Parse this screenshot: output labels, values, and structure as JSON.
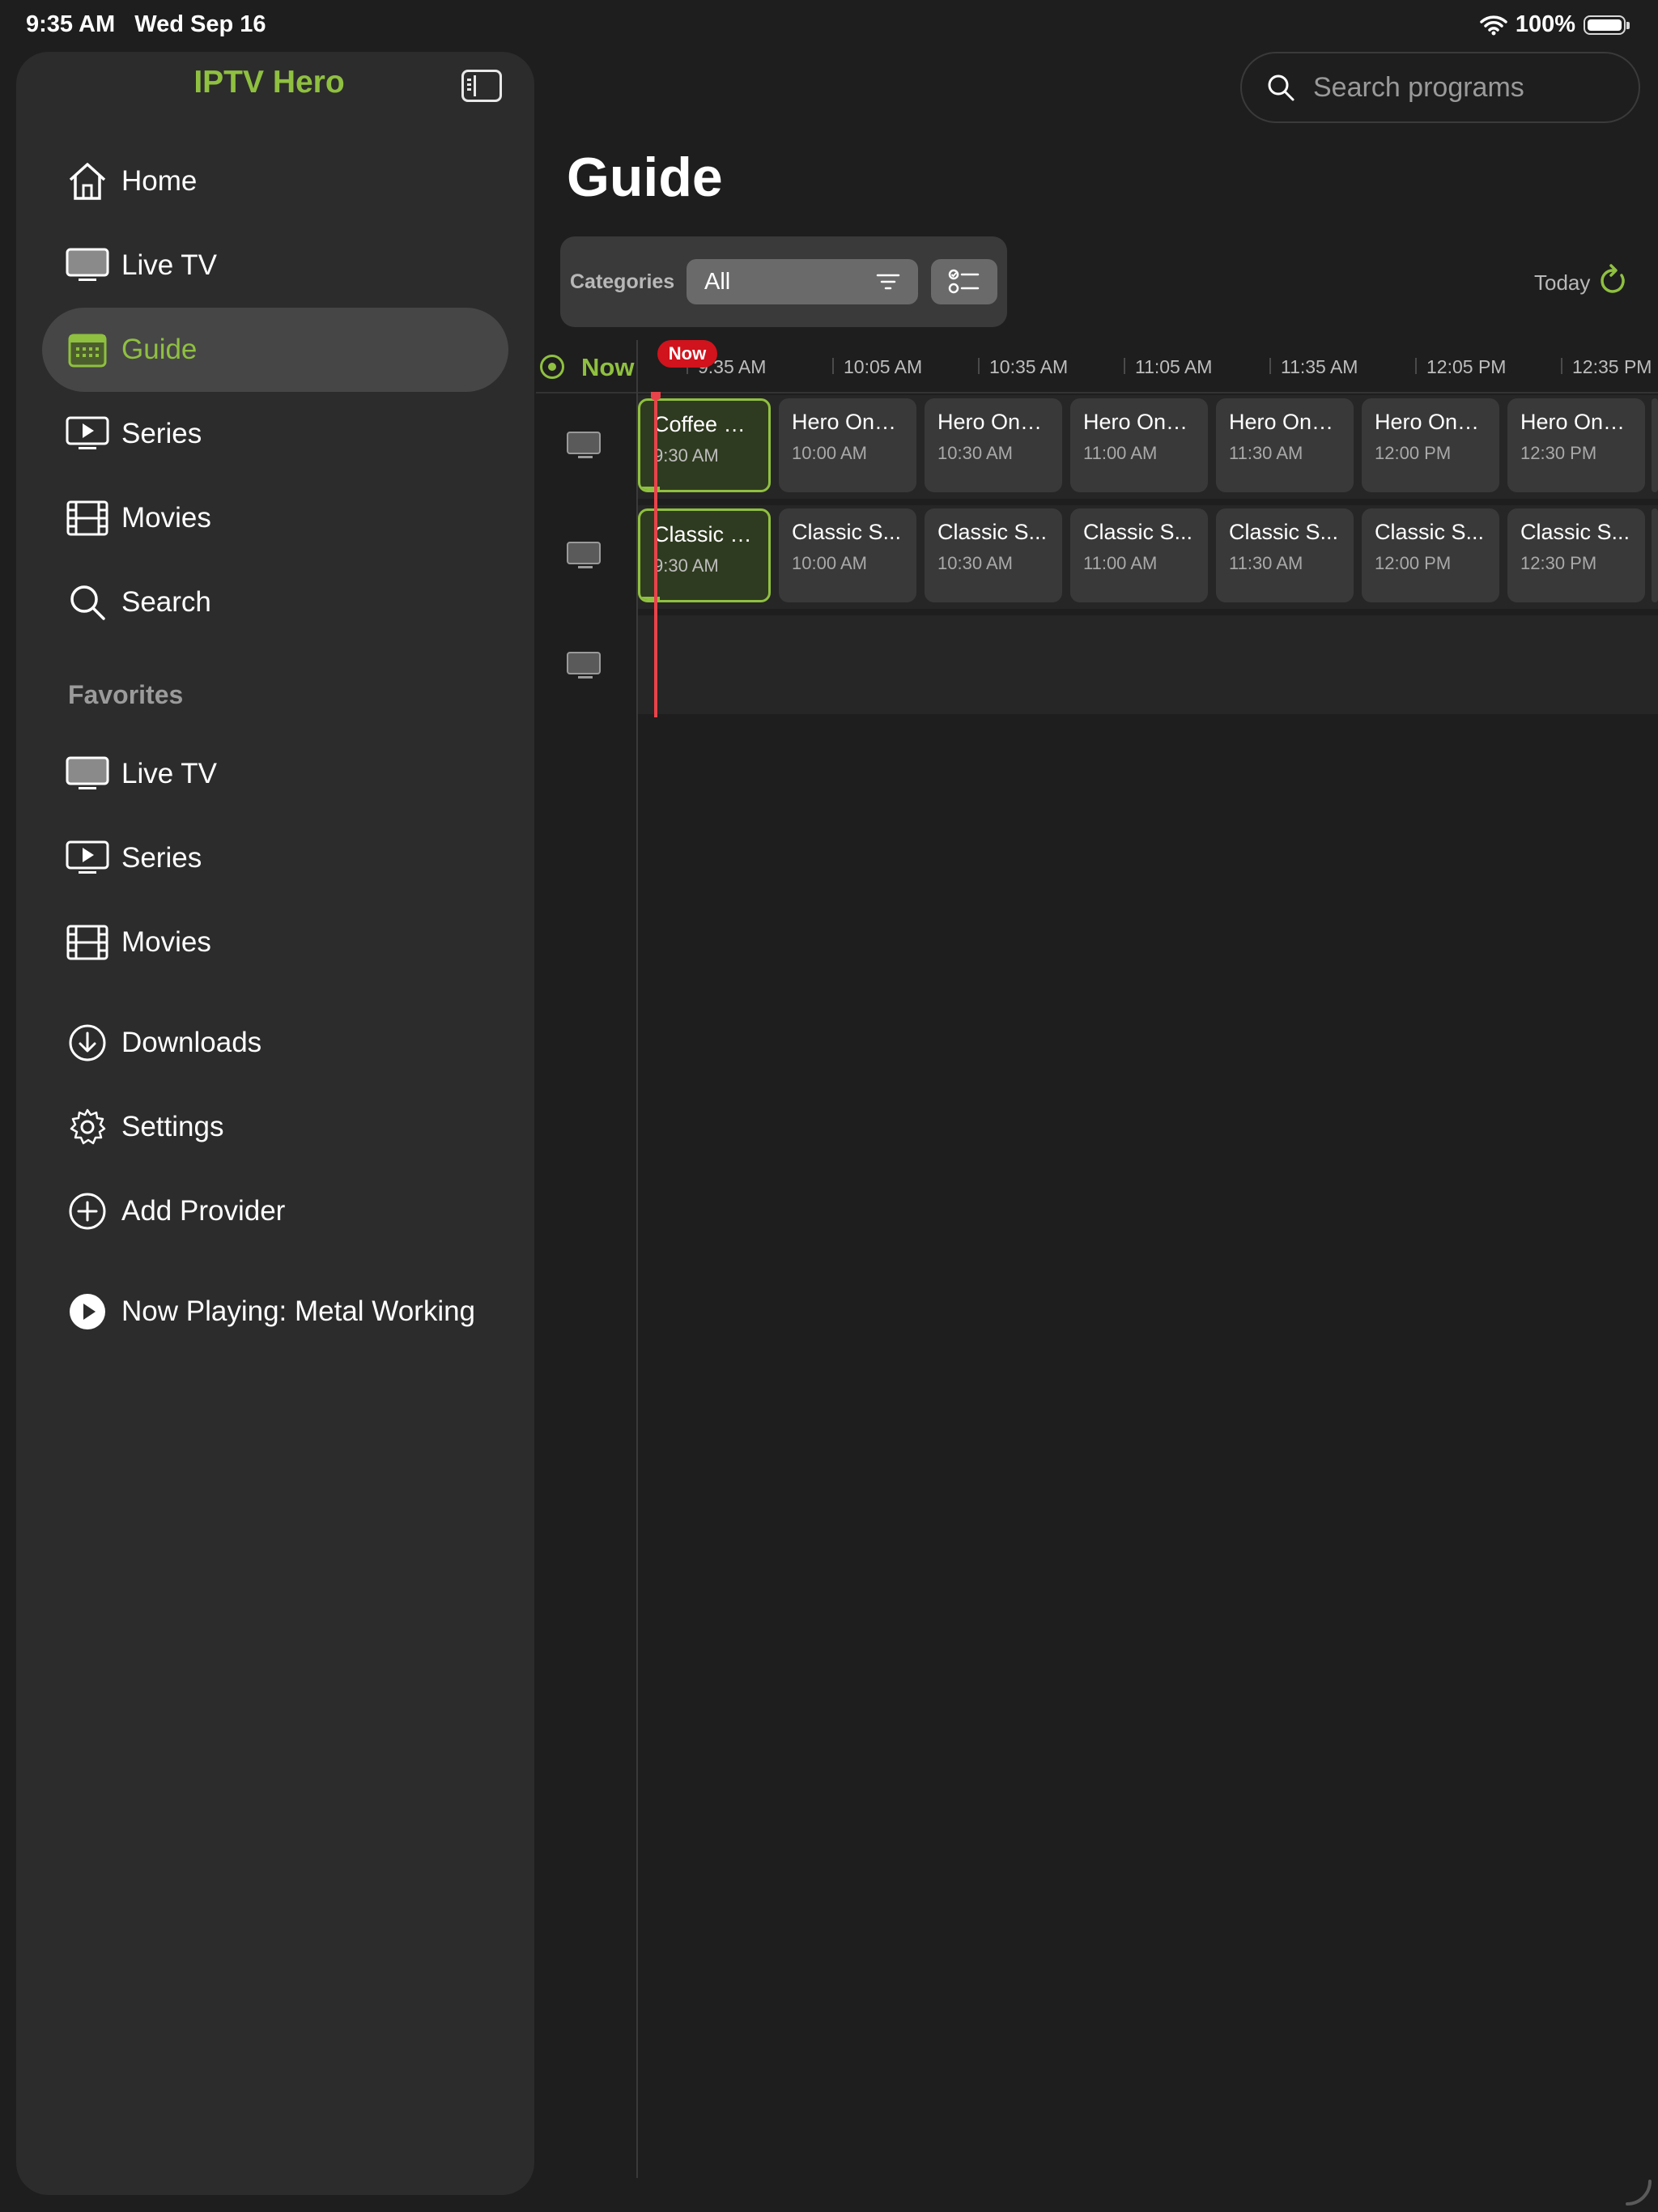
{
  "status_bar": {
    "time": "9:35 AM",
    "date": "Wed Sep 16",
    "battery": "100%"
  },
  "sidebar": {
    "app_title": "IPTV Hero",
    "items": [
      {
        "label": "Home",
        "icon": "house-icon"
      },
      {
        "label": "Live TV",
        "icon": "tv-icon"
      },
      {
        "label": "Guide",
        "icon": "calendar-icon",
        "active": true
      },
      {
        "label": "Series",
        "icon": "play-rectangle-icon"
      },
      {
        "label": "Movies",
        "icon": "film-icon"
      },
      {
        "label": "Search",
        "icon": "search-icon"
      }
    ],
    "favorites_label": "Favorites",
    "favorites": [
      {
        "label": "Live TV",
        "icon": "tv-icon"
      },
      {
        "label": "Series",
        "icon": "play-rectangle-icon"
      },
      {
        "label": "Movies",
        "icon": "film-icon"
      }
    ],
    "extras": [
      {
        "label": "Downloads",
        "icon": "download-circle-icon"
      },
      {
        "label": "Settings",
        "icon": "gear-icon"
      },
      {
        "label": "Add Provider",
        "icon": "plus-circle-icon"
      }
    ],
    "now_playing": "Now Playing: Metal Working"
  },
  "header": {
    "search_placeholder": "Search programs",
    "title": "Guide"
  },
  "filters": {
    "categories_label": "Categories",
    "selected": "All",
    "today_label": "Today"
  },
  "timeline": {
    "now_label": "Now",
    "now_badge": "Now",
    "times": [
      "9:35 AM",
      "10:05 AM",
      "10:35 AM",
      "11:05 AM",
      "11:35 AM",
      "12:05 PM",
      "12:35 PM"
    ]
  },
  "channels": [
    {
      "programs": [
        {
          "title": "Coffee &...",
          "time": "9:30 AM",
          "current": true,
          "progress": 0.15
        },
        {
          "title": "Hero One...",
          "time": "10:00 AM"
        },
        {
          "title": "Hero One...",
          "time": "10:30 AM"
        },
        {
          "title": "Hero One...",
          "time": "11:00 AM"
        },
        {
          "title": "Hero One...",
          "time": "11:30 AM"
        },
        {
          "title": "Hero One...",
          "time": "12:00 PM"
        },
        {
          "title": "Hero One...",
          "time": "12:30 PM"
        }
      ]
    },
    {
      "programs": [
        {
          "title": "Classic S...",
          "time": "9:30 AM",
          "current": true,
          "progress": 0.15
        },
        {
          "title": "Classic S...",
          "time": "10:00 AM"
        },
        {
          "title": "Classic S...",
          "time": "10:30 AM"
        },
        {
          "title": "Classic S...",
          "time": "11:00 AM"
        },
        {
          "title": "Classic S...",
          "time": "11:30 AM"
        },
        {
          "title": "Classic S...",
          "time": "12:00 PM"
        },
        {
          "title": "Classic S...",
          "time": "12:30 PM"
        }
      ]
    },
    {
      "programs": []
    }
  ],
  "colors": {
    "accent": "#8fc040",
    "now_red": "#d0131c"
  }
}
